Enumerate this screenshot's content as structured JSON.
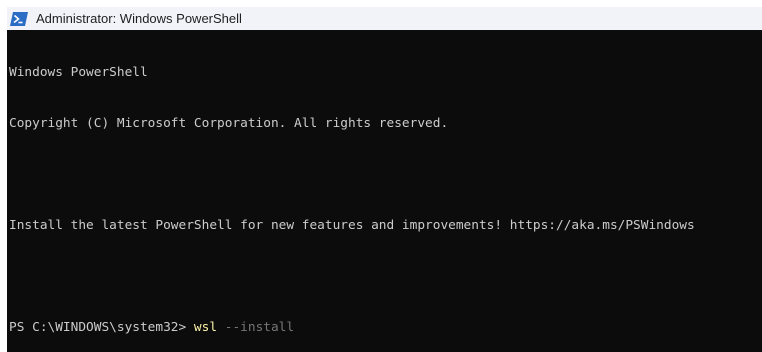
{
  "window": {
    "title": "Administrator: Windows PowerShell",
    "icon": "powershell-icon",
    "colors": {
      "titlebar_bg": "#f1f3f9",
      "console_bg": "#0c0c0c",
      "console_text": "#cccccc",
      "command_color": "#f9f1a5",
      "parameter_color": "#767676",
      "icon_blue": "#2b6cc4"
    }
  },
  "console": {
    "banner_line1": "Windows PowerShell",
    "banner_line2": "Copyright (C) Microsoft Corporation. All rights reserved.",
    "install_message": "Install the latest PowerShell for new features and improvements! https://aka.ms/PSWindows",
    "prompt": "PS C:\\WINDOWS\\system32> ",
    "command": "wsl",
    "space": " ",
    "parameter": "--install"
  }
}
